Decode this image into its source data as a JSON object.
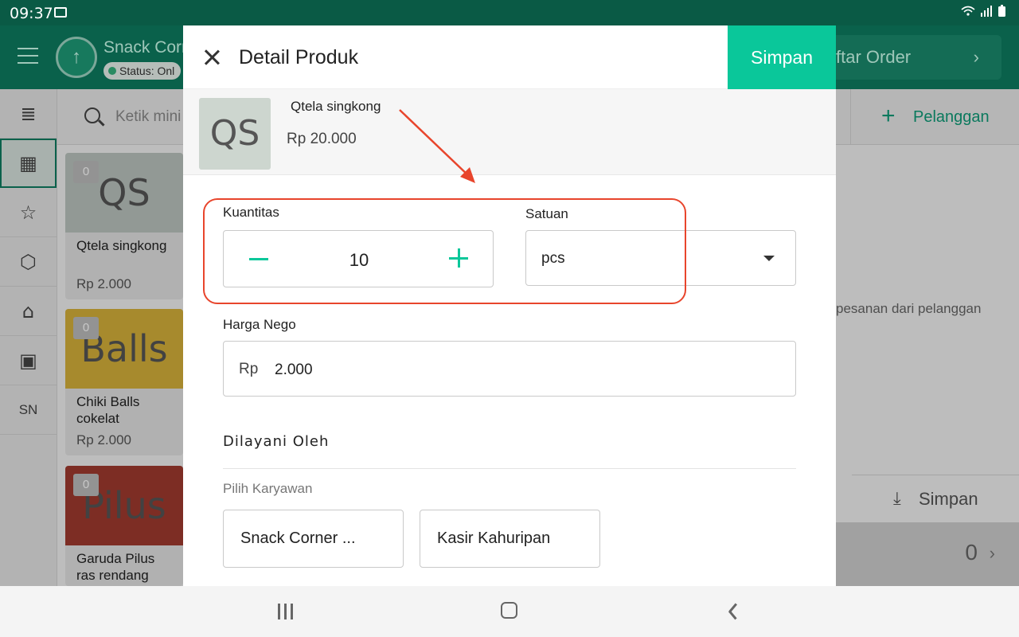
{
  "status_bar": {
    "time": "09:37",
    "icons": "wifi signal battery"
  },
  "app_bar": {
    "store_initials": "↑",
    "store_name": "Snack Corr",
    "status_label": "Status: Onl",
    "order_label": "ftar Order",
    "order_chevron": "›"
  },
  "rail": {
    "items": [
      "≣",
      "▦",
      "☆",
      "⬡",
      "⌂",
      "▣"
    ],
    "sn_label": "SN"
  },
  "search": {
    "placeholder": "Ketik mini"
  },
  "pelanggan": {
    "plus": "+",
    "label": "Pelanggan"
  },
  "products": [
    {
      "initials": "QS",
      "badge": "0",
      "name": "Qtela singkong",
      "price": "Rp 2.000"
    },
    {
      "initials": "Balls",
      "badge": "0",
      "name": "Chiki Balls cokelat",
      "price": "Rp 2.000"
    },
    {
      "initials": "Pilus",
      "badge": "0",
      "name": "Garuda Pilus ras rendang",
      "price": ""
    }
  ],
  "right_panel": {
    "hint": "pesanan dari pelanggan",
    "save_label": "Simpan",
    "save_icon": "⤓",
    "total_count": "0",
    "total_chevron": "›"
  },
  "modal": {
    "title": "Detail Produk",
    "save_label": "Simpan",
    "product": {
      "initials": "QS",
      "name": "Qtela singkong",
      "price": "Rp 20.000"
    },
    "quantity": {
      "label": "Kuantitas",
      "value": "10"
    },
    "unit": {
      "label": "Satuan",
      "value": "pcs"
    },
    "nego": {
      "label": "Harga Nego",
      "currency": "Rp",
      "value": "2.000"
    },
    "served_by": {
      "title": "Dilayani Oleh",
      "sub_label": "Pilih Karyawan",
      "employees": [
        "Snack Corner ...",
        "Kasir Kahuripan"
      ]
    }
  },
  "annotation_color": "#e8452c",
  "accent_color": "#0ac79a"
}
